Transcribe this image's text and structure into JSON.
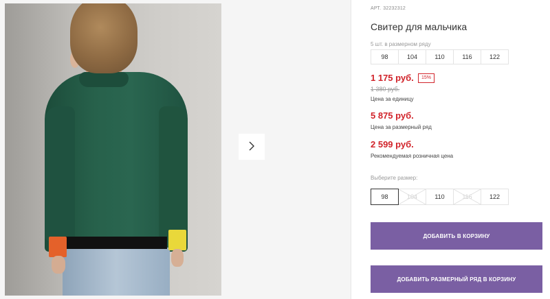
{
  "gallery": {
    "next_icon": "chevron-right-icon"
  },
  "product": {
    "article_label": "АРТ.",
    "article_number": "32232312",
    "title": "Свитер для мальчика",
    "size_range_label": "5 шт. в размерном ряду",
    "size_range": [
      "98",
      "104",
      "110",
      "116",
      "122"
    ]
  },
  "pricing": {
    "unit_price": "1 175 руб.",
    "discount_badge": "15%",
    "old_price": "1 380 руб.",
    "unit_price_note": "Цена за единицу",
    "range_price": "5 875 руб.",
    "range_price_note": "Цена за размерный ряд",
    "retail_price": "2 599 руб.",
    "retail_price_note": "Рекомендуемая розничная цена",
    "accent_color": "#d1232a"
  },
  "size_picker": {
    "label": "Выберите размер:",
    "sizes": [
      {
        "value": "98",
        "state": "selected"
      },
      {
        "value": "104",
        "state": "unavailable"
      },
      {
        "value": "110",
        "state": "available"
      },
      {
        "value": "116",
        "state": "unavailable"
      },
      {
        "value": "122",
        "state": "available"
      }
    ]
  },
  "actions": {
    "add_to_cart": "ДОБАВИТЬ В КОРЗИНУ",
    "add_range_to_cart": "ДОБАВИТЬ РАЗМЕРНЫЙ РЯД В КОРЗИНУ",
    "button_color": "#7a5fa3"
  }
}
